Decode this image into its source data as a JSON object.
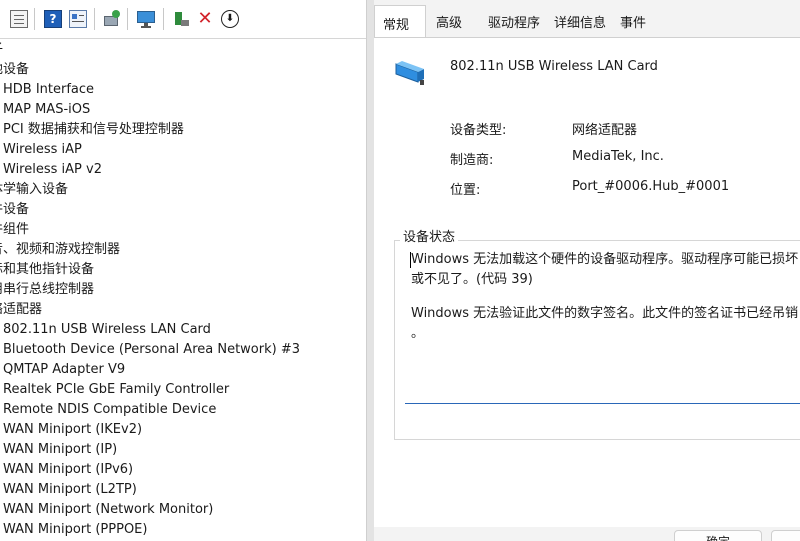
{
  "device_manager": {
    "toolbar_icons": [
      "properties-icon",
      "help-icon",
      "properties-sheet-icon",
      "scan-hardware-icon",
      "monitor-icon",
      "enable-device-icon",
      "uninstall-icon",
      "update-driver-icon"
    ],
    "tree": [
      {
        "label": "子",
        "type": "category"
      },
      {
        "label": "他设备",
        "type": "category"
      },
      {
        "label": "HDB Interface",
        "type": "child"
      },
      {
        "label": "MAP MAS-iOS",
        "type": "child"
      },
      {
        "label": "PCI 数据捕获和信号处理控制器",
        "type": "child"
      },
      {
        "label": "Wireless iAP",
        "type": "child"
      },
      {
        "label": "Wireless iAP v2",
        "type": "child"
      },
      {
        "label": "体学输入设备",
        "type": "category"
      },
      {
        "label": "件设备",
        "type": "category"
      },
      {
        "label": "件组件",
        "type": "category"
      },
      {
        "label": "音、视频和游戏控制器",
        "type": "category"
      },
      {
        "label": "标和其他指针设备",
        "type": "category"
      },
      {
        "label": "用串行总线控制器",
        "type": "category"
      },
      {
        "label": "络适配器",
        "type": "category"
      },
      {
        "label": "802.11n USB Wireless LAN Card",
        "type": "child"
      },
      {
        "label": "Bluetooth Device (Personal Area Network) #3",
        "type": "child"
      },
      {
        "label": "QMTAP Adapter V9",
        "type": "child"
      },
      {
        "label": "Realtek PCIe GbE Family Controller",
        "type": "child"
      },
      {
        "label": "Remote NDIS Compatible Device",
        "type": "child"
      },
      {
        "label": "WAN Miniport (IKEv2)",
        "type": "child"
      },
      {
        "label": "WAN Miniport (IP)",
        "type": "child"
      },
      {
        "label": "WAN Miniport (IPv6)",
        "type": "child"
      },
      {
        "label": "WAN Miniport (L2TP)",
        "type": "child"
      },
      {
        "label": "WAN Miniport (Network Monitor)",
        "type": "child"
      },
      {
        "label": "WAN Miniport (PPPOE)",
        "type": "child"
      }
    ]
  },
  "properties_dialog": {
    "tabs": [
      "常规",
      "高级",
      "驱动程序",
      "详细信息",
      "事件"
    ],
    "active_tab": "常规",
    "device_name": "802.11n USB Wireless LAN Card",
    "device_icon": "network-adapter-icon",
    "props": [
      {
        "label": "设备类型:",
        "value": "网络适配器"
      },
      {
        "label": "制造商:",
        "value": "MediaTek, Inc."
      },
      {
        "label": "位置:",
        "value": "Port_#0006.Hub_#0001"
      }
    ],
    "status_title": "设备状态",
    "status_lines": [
      "Windows 无法加载这个硬件的设备驱动程序。驱动程序可能已损坏",
      "或不见了。(代码 39)",
      "",
      "Windows 无法验证此文件的数字签名。此文件的签名证书已经吊销",
      "。"
    ],
    "buttons": {
      "ok": "确定"
    }
  },
  "colors": {
    "accent": "#2a67b8",
    "dialog_bg": "#f3f3f3",
    "uninstall_red": "#d2232a"
  }
}
